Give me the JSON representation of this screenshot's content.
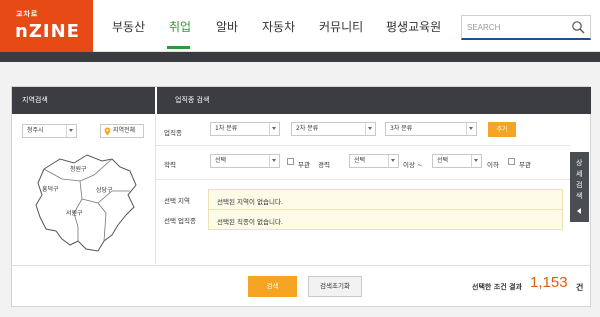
{
  "logo": {
    "small": "교차로",
    "big": "nZINE"
  },
  "nav": {
    "items": [
      "부동산",
      "취업",
      "알바",
      "자동차",
      "커뮤니티",
      "평생교육원"
    ],
    "active_index": 1,
    "active_color": "#2e9b3b"
  },
  "search": {
    "placeholder": "SEARCH",
    "icon": "search-icon"
  },
  "region": {
    "title": "지역검색",
    "city_select": "청주시",
    "whole_region_button": "지역전체",
    "districts": [
      "청원구",
      "흥덕구",
      "상당구",
      "서원구"
    ]
  },
  "business": {
    "title": "업직종 검색",
    "category_label": "업직종",
    "category_1": "1차 분류",
    "category_2": "2차 분류",
    "category_3": "3차 분류",
    "add_button": "추가",
    "education_label": "학력",
    "education_select": "선택",
    "no_matter_1": "무관",
    "career_label": "경력",
    "career_min_select": "선택",
    "career_above": "이상 ~",
    "career_max_select": "선택",
    "career_below": "이하",
    "no_matter_2": "무관",
    "selected_region_label": "선택 지역",
    "selected_region_value": "선택된 지역이 없습니다.",
    "selected_job_label": "선택 업직종",
    "selected_job_value": "선택된 직종이 없습니다."
  },
  "side_tab": {
    "label": "상세검색"
  },
  "footer": {
    "search_button": "검색",
    "reset_button": "검색초기화",
    "result_label": "선택한 조건 결과",
    "result_count": "1,153",
    "result_unit": "건"
  },
  "colors": {
    "brand": "#e84a16",
    "accent": "#f5a423",
    "count": "#e35a12",
    "dark": "#3b3d42"
  }
}
